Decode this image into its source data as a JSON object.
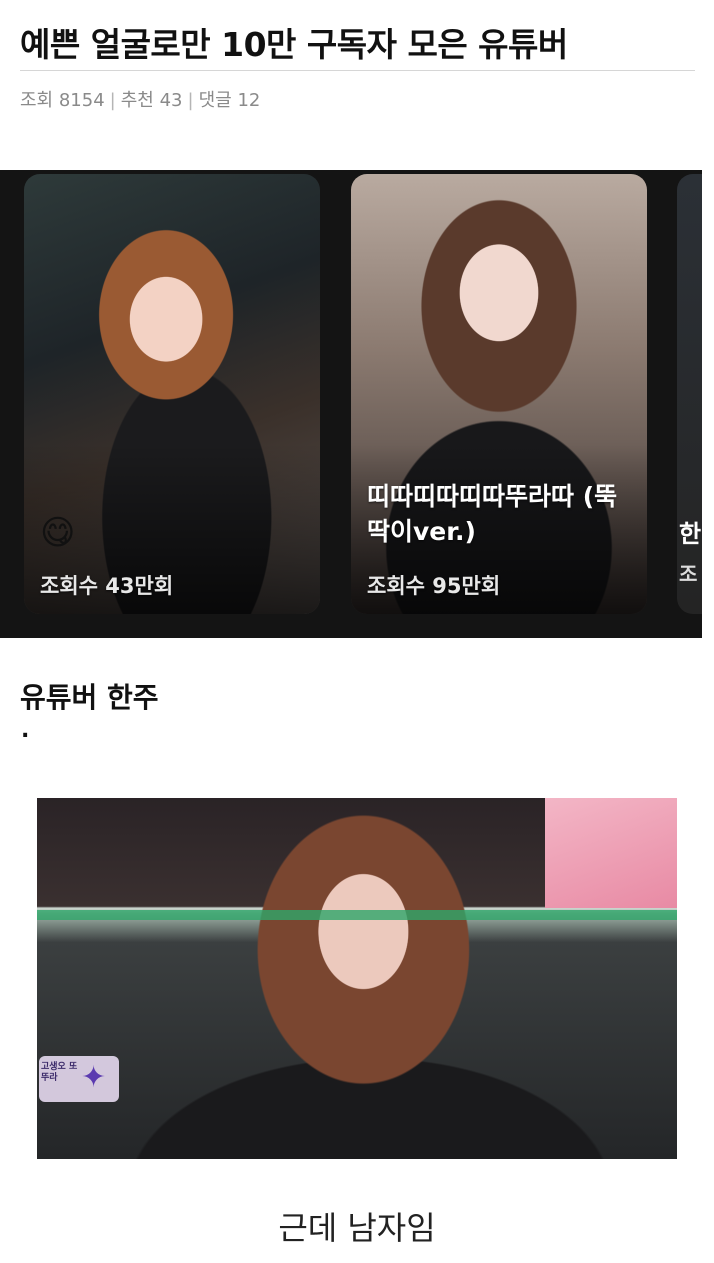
{
  "post": {
    "title": "예쁜 얼굴로만 10만 구독자 모은 유튜버",
    "meta": {
      "views_label": "조회",
      "views": "8154",
      "recommend_label": "추천",
      "recommend": "43",
      "comments_label": "댓글",
      "comments": "12",
      "separator": "|"
    }
  },
  "shorts": [
    {
      "title": "",
      "emoji": "😋",
      "views": "조회수 43만회"
    },
    {
      "title": "띠따띠따띠따뚜라따 (뚝딱이ver.)",
      "views": "조회수 95만회"
    },
    {
      "title_partial": "한",
      "views_partial": "조"
    }
  ],
  "body": {
    "section_heading": "유튜버 한주",
    "dot": ".",
    "caption": "근데 남자임"
  },
  "photo": {
    "badge_text": "고생오 또 뚜라"
  }
}
